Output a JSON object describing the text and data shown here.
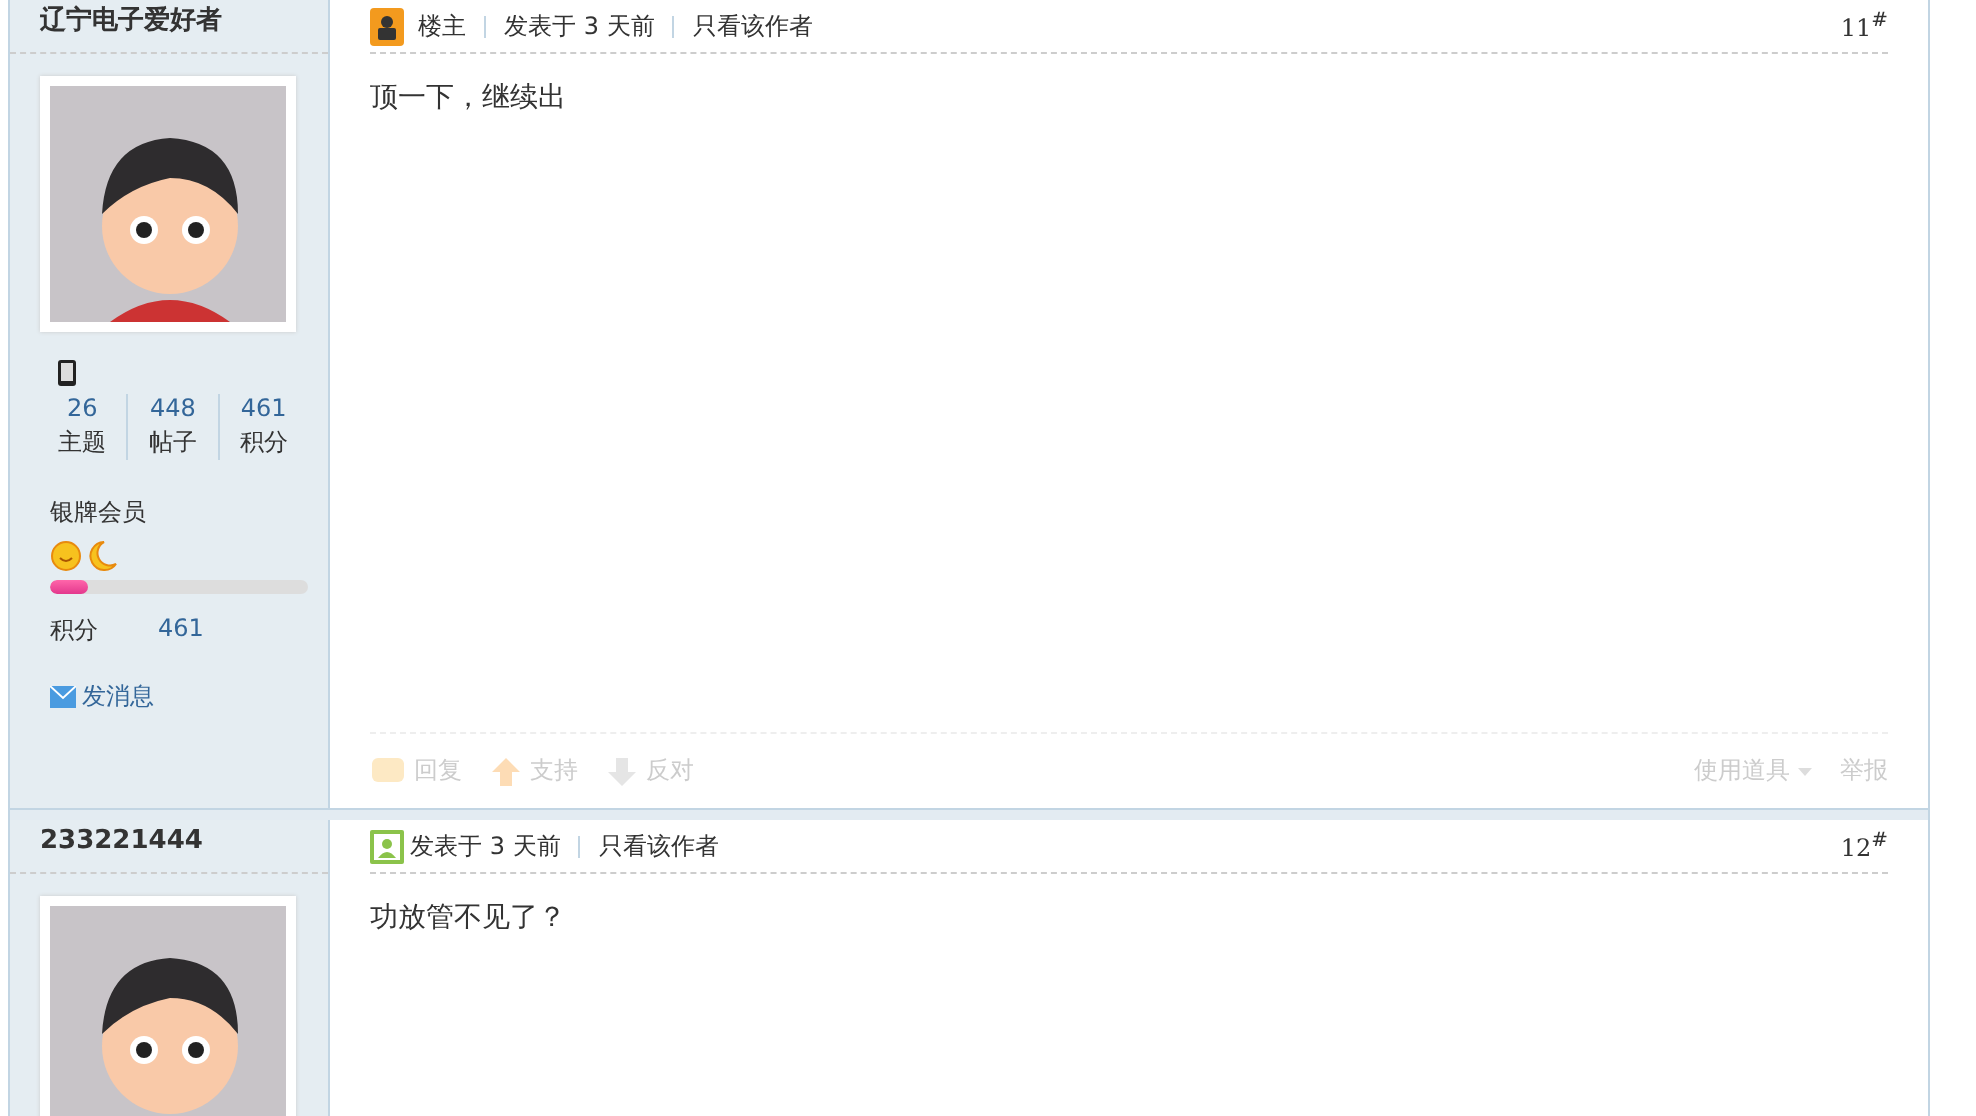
{
  "posts": [
    {
      "author": "辽宁电子爱好者",
      "badge": {
        "kind": "op",
        "label": "楼主"
      },
      "posted_label": "发表于",
      "posted_time": "3 天前",
      "only_author": "只看该作者",
      "floor": "11",
      "floor_mark": "#",
      "content": "顶一下，继续出",
      "profile": {
        "stats": [
          {
            "value": "26",
            "label": "主题"
          },
          {
            "value": "448",
            "label": "帖子"
          },
          {
            "value": "461",
            "label": "积分"
          }
        ],
        "group": "银牌会员",
        "level": 0.15,
        "points_label": "积分",
        "points_value": "461",
        "message": "发消息"
      },
      "actions": [
        {
          "kind": "reply",
          "label": "回复"
        },
        {
          "kind": "support",
          "label": "支持"
        },
        {
          "kind": "oppose",
          "label": "反对"
        }
      ],
      "tools": "使用道具",
      "report": "举报"
    },
    {
      "author": "233221444",
      "badge": {
        "kind": "member"
      },
      "posted_label": "发表于",
      "posted_time": "3 天前",
      "only_author": "只看该作者",
      "floor": "12",
      "floor_mark": "#",
      "content": "功放管不见了？"
    }
  ]
}
